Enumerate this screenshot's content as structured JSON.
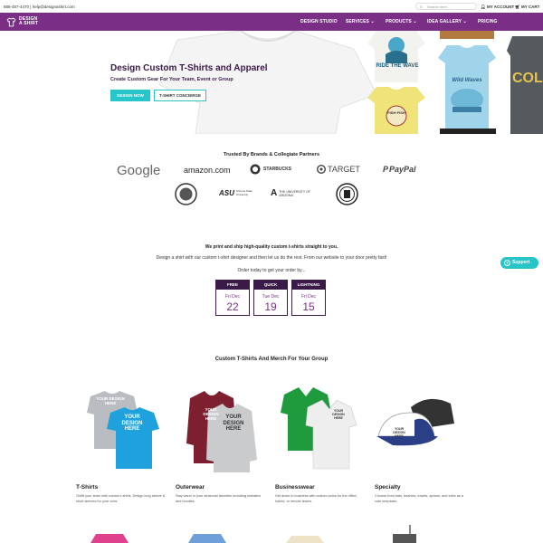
{
  "topbar": {
    "contact": "888-487-4470 | help@designashirt.com",
    "search_placeholder": "Search here...",
    "account": "MY ACCOUNT",
    "cart": "MY CART"
  },
  "logo": {
    "line1": "DESIGN",
    "line2": "A SHIRT"
  },
  "nav": [
    {
      "label": "DESIGN STUDIO"
    },
    {
      "label": "SERVICES ⌄"
    },
    {
      "label": "PRODUCTS ⌄"
    },
    {
      "label": "IDEA GALLERY ⌄"
    },
    {
      "label": "PRICING"
    }
  ],
  "hero": {
    "title": "Design Custom T-Shirts and Apparel",
    "subtitle": "Create Custom Gear For Your Team, Event or Group",
    "btn_design": "DESIGN NOW",
    "btn_concierge": "T-SHIRT CONCIERGE",
    "tees": {
      "ride": "RIDE THE WAVE",
      "fish": "FISH·FISH",
      "wild": "Wild Waves",
      "col": "COL"
    }
  },
  "partners": {
    "title": "Trusted By Brands & Collegiate Partners",
    "google": "Google",
    "amazon": "amazon.com",
    "starbucks": "STARBUCKS",
    "target": "TARGET",
    "paypal": "PayPal",
    "asu": "ASU",
    "asu_sub": "Arizona State University",
    "arizona": "THE UNIVERSITY OF ARIZONA"
  },
  "shipping": {
    "line1": "We print and ship high-quality custom t-shirts straight to you.",
    "line2": "Design a shirt with our custom t-shirt designer and then let us do the rest. From our website to your door pretty fast!",
    "line3": "Order today to get your order by...",
    "options": [
      {
        "label": "FREE",
        "day": "Fri Dec",
        "date": "22"
      },
      {
        "label": "QUICK",
        "day": "Tue Dec",
        "date": "19"
      },
      {
        "label": "LIGHTNING",
        "day": "Fri Dec",
        "date": "15"
      }
    ]
  },
  "support": "Support",
  "categories": {
    "title": "Custom T-Shirts And Merch For Your Group",
    "mock_text": "YOUR DESIGN HERE",
    "items": [
      {
        "name": "T-Shirts",
        "desc": "Outfit your team with custom t-shirts. Design long sleeve & short sleeves for your crew."
      },
      {
        "name": "Outerwear",
        "desc": "Stay warm in your seasonal favorites including sweaters and hoodies."
      },
      {
        "name": "Businesswear",
        "desc": "Get down to business with custom polos for the office, hybrid, or remote teams."
      },
      {
        "name": "Specialty",
        "desc": "Choose from hats, beanies, towels, aprons, and totes as a cute keepsake."
      }
    ]
  },
  "colors": {
    "brand_purple": "#7a2e86",
    "dark_purple": "#3a1a46",
    "teal": "#27c5c9"
  }
}
